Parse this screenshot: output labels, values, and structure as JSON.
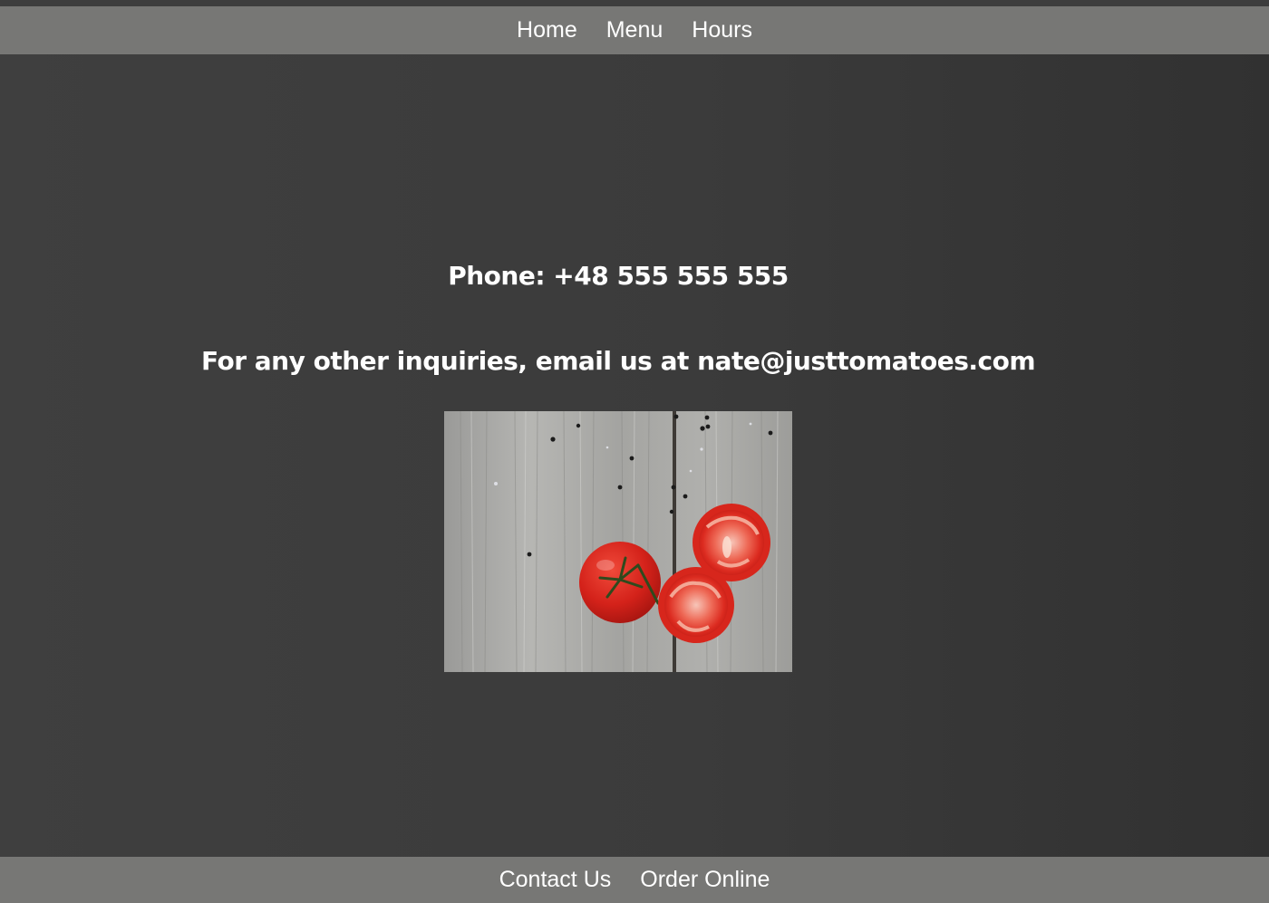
{
  "nav": {
    "items": [
      {
        "label": "Home"
      },
      {
        "label": "Menu"
      },
      {
        "label": "Hours"
      }
    ]
  },
  "contact": {
    "phone_text": "Phone: +48 555 555 555",
    "inquiry_text": "For any other inquiries, email us at nate@justtomatoes.com"
  },
  "image": {
    "subject": "tomatoes-on-wooden-table"
  },
  "footer": {
    "items": [
      {
        "label": "Contact Us"
      },
      {
        "label": "Order Online"
      }
    ]
  },
  "colors": {
    "nav_bar": "#777775",
    "background": "#3b3b3b",
    "text": "#ffffff",
    "tomato": "#d8211b"
  }
}
